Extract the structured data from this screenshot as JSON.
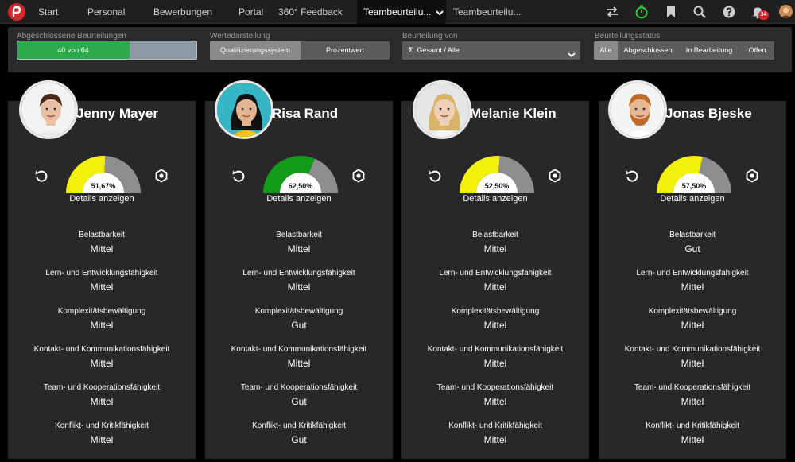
{
  "nav": {
    "tabs": [
      "Start",
      "Personal",
      "Bewerbungen",
      "Portal",
      "360° Feedback",
      "Teambeurteilu...",
      "Teambeurteilu..."
    ],
    "notification_count": "34"
  },
  "filters": {
    "completed": {
      "label": "Abgeschlossene Beurteilungen",
      "text": "40 von 64",
      "progress_fraction": 0.625
    },
    "display": {
      "label": "Wertedarstellung",
      "options": [
        "Qualifizierungssystem",
        "Prozentwert"
      ],
      "selected": "Qualifizierungssystem"
    },
    "rating_by": {
      "label": "Beurteilung von",
      "value": "Gesamt / Alle"
    },
    "status": {
      "label": "Beurteilungsstatus",
      "options": [
        "Alle",
        "Abgeschlossen",
        "In Bearbeitung",
        "Offen"
      ],
      "selected": "Alle"
    }
  },
  "criteria_labels": [
    "Belastbarkeit",
    "Lern- und Entwicklungsfähigkeit",
    "Komplexitätsbewältigung",
    "Kontakt- und Kommunikationsfähigkeit",
    "Team- und Kooperationsfähigkeit",
    "Konflikt- und Kritikfähigkeit"
  ],
  "details_label": "Details anzeigen",
  "people": [
    {
      "name": "Jenny Mayer",
      "percent_text": "51,67%",
      "percent": 51.67,
      "gauge_color": "#f4f00a",
      "ratings": [
        "Mittel",
        "Mittel",
        "Mittel",
        "Mittel",
        "Mittel",
        "Mittel"
      ]
    },
    {
      "name": "Risa Rand",
      "percent_text": "62,50%",
      "percent": 62.5,
      "gauge_color": "#129a19",
      "ratings": [
        "Mittel",
        "Mittel",
        "Gut",
        "Mittel",
        "Gut",
        "Gut"
      ]
    },
    {
      "name": "Melanie Klein",
      "percent_text": "52,50%",
      "percent": 52.5,
      "gauge_color": "#f4f00a",
      "ratings": [
        "Mittel",
        "Mittel",
        "Mittel",
        "Mittel",
        "Mittel",
        "Mittel"
      ]
    },
    {
      "name": "Jonas Bjeske",
      "percent_text": "57,50%",
      "percent": 57.5,
      "gauge_color": "#f4f00a",
      "ratings": [
        "Gut",
        "Mittel",
        "Mittel",
        "Mittel",
        "Mittel",
        "Mittel"
      ]
    }
  ],
  "colors": {
    "gauge_rest": "#8e8e8e",
    "progress_fill": "#2bab4a"
  }
}
